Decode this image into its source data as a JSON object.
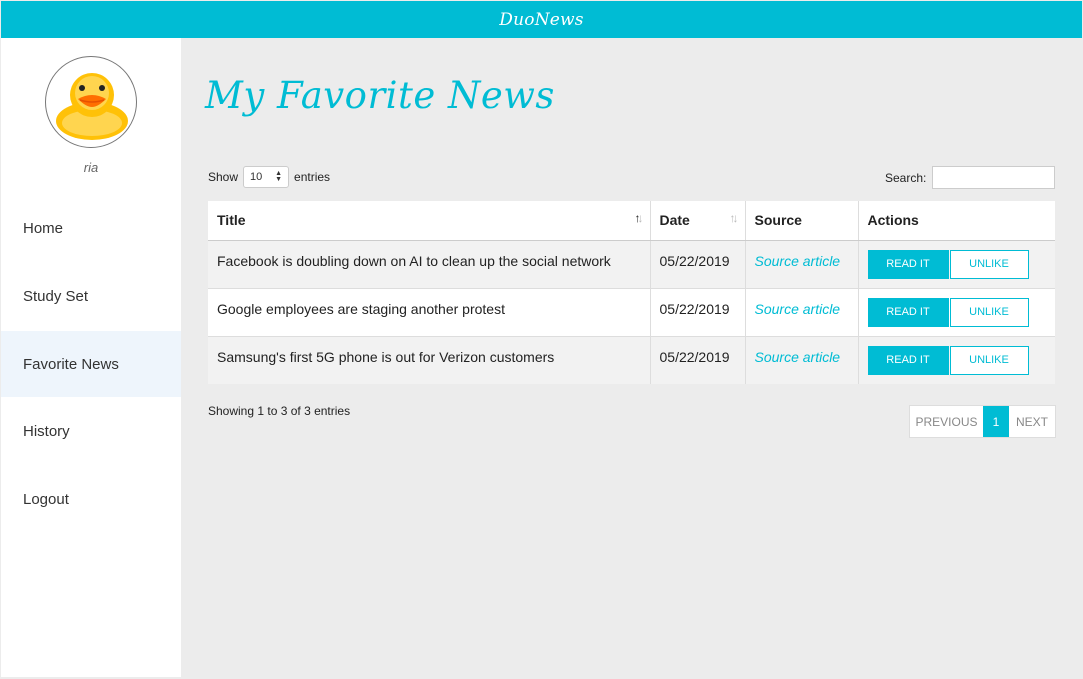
{
  "app": {
    "brand": "DuoNews"
  },
  "user": {
    "name": "ria"
  },
  "sidebar": {
    "items": [
      {
        "label": "Home"
      },
      {
        "label": "Study Set"
      },
      {
        "label": "Favorite News"
      },
      {
        "label": "History"
      },
      {
        "label": "Logout"
      }
    ],
    "active": "Favorite News"
  },
  "main": {
    "title": "My Favorite News",
    "show_label": "Show",
    "entries_label": "entries",
    "page_length": "10",
    "search_label": "Search:",
    "search_value": "",
    "columns": [
      "Title",
      "Date",
      "Source",
      "Actions"
    ],
    "rows": [
      {
        "title": "Facebook is doubling down on AI to clean up the social network",
        "date": "05/22/2019",
        "source": "Source article",
        "read": "READ IT",
        "unlike": "UNLIKE"
      },
      {
        "title": "Google employees are staging another protest",
        "date": "05/22/2019",
        "source": "Source article",
        "read": "READ IT",
        "unlike": "UNLIKE"
      },
      {
        "title": "Samsung's first 5G phone is out for Verizon customers",
        "date": "05/22/2019",
        "source": "Source article",
        "read": "READ IT",
        "unlike": "UNLIKE"
      }
    ],
    "info": "Showing 1 to 3 of 3 entries",
    "pager": {
      "previous": "PREVIOUS",
      "current": "1",
      "next": "NEXT"
    }
  },
  "colors": {
    "accent": "#00bcd4",
    "active_nav": "#eef5fc",
    "background": "#ececec"
  },
  "icons": [
    "duck-avatar",
    "sort-icon",
    "select-arrows-icon"
  ]
}
